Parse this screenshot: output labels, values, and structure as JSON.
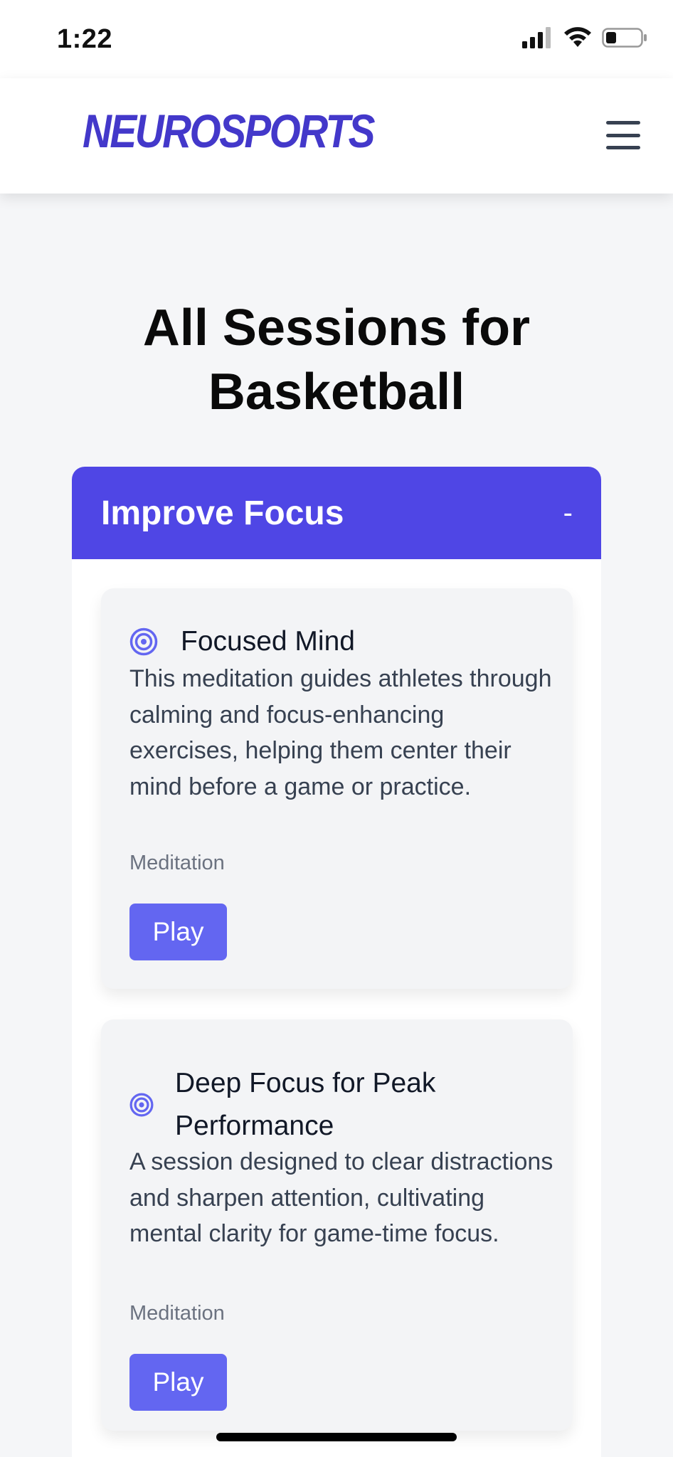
{
  "status_bar": {
    "time": "1:22",
    "icons": [
      "cellular-signal-icon",
      "wifi-icon",
      "battery-icon"
    ]
  },
  "header": {
    "logo_text": "NEUROSPORTS",
    "menu_icon": "hamburger-menu-icon"
  },
  "page": {
    "title_line1": "All Sessions for",
    "title_line2": "Basketball"
  },
  "category": {
    "title": "Improve Focus",
    "toggle": "-",
    "sessions": [
      {
        "icon": "target-icon",
        "title": "Focused Mind",
        "description": "This meditation guides athletes through calming and focus-enhancing exercises, helping them center their mind before a game or practice.",
        "type": "Meditation",
        "play_label": "Play"
      },
      {
        "icon": "target-icon",
        "title": "Deep Focus for Peak Performance",
        "description": "A session designed to clear distractions and sharpen attention, cultivating mental clarity for game-time focus.",
        "type": "Meditation",
        "play_label": "Play"
      }
    ]
  },
  "colors": {
    "brand": "#4338ca",
    "category_header": "#4f46e5",
    "play_button": "#6366f1",
    "card_bg": "#f3f4f6"
  }
}
